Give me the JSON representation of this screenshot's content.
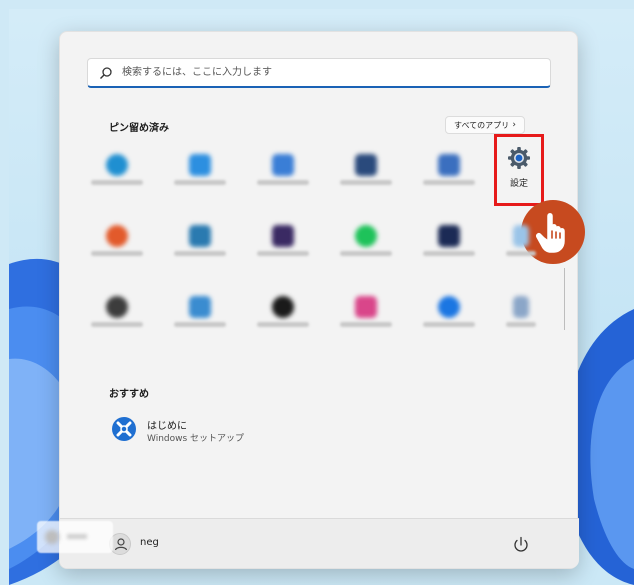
{
  "search": {
    "placeholder": "検索するには、ここに入力します"
  },
  "pinned": {
    "title": "ピン留め済み",
    "all_apps_label": "すべてのアプリ",
    "apps": [
      {
        "icon": "edge-icon",
        "color": "#1f8fd1",
        "round": true
      },
      {
        "icon": "mail-icon",
        "color": "#2c8fe0"
      },
      {
        "icon": "calendar-icon",
        "color": "#3a7ed6"
      },
      {
        "icon": "store-icon",
        "color": "#2a4a7c"
      },
      {
        "icon": "photos-icon",
        "color": "#3b6fbf"
      },
      {
        "icon": "office-icon",
        "color": "#e25a2b",
        "round": true
      },
      {
        "icon": "solitaire-icon",
        "color": "#2a7ab0"
      },
      {
        "icon": "clipchamp-icon",
        "color": "#3a2a63"
      },
      {
        "icon": "spotify-icon",
        "color": "#1ec25a",
        "round": true
      },
      {
        "icon": "disney-icon",
        "color": "#1b2a55"
      },
      {
        "icon": "netflix-icon",
        "color": "#3c3c3c",
        "round": true
      },
      {
        "icon": "photoshop-express-icon",
        "color": "#3a8cd0"
      },
      {
        "icon": "tiktok-icon",
        "color": "#1a1a1a",
        "round": true
      },
      {
        "icon": "instagram-icon",
        "color": "#d9468a"
      },
      {
        "icon": "facebook-icon",
        "color": "#1b76e2",
        "round": true
      }
    ],
    "extra_column": [
      {
        "icon": "unknown-app-icon",
        "color": "#9ac4e8"
      },
      {
        "icon": "unknown-app-icon",
        "color": "#8ba6c8"
      }
    ],
    "settings": {
      "label": "設定"
    }
  },
  "recommended": {
    "title": "おすすめ",
    "items": [
      {
        "title": "はじめに",
        "subtitle": "Windows セットアップ",
        "icon": "get-started-icon"
      }
    ]
  },
  "footer": {
    "user_name": "neg"
  },
  "colors": {
    "accent": "#1a62b5",
    "highlight": "#e61a1a",
    "cursor_badge": "#c74a1f"
  }
}
